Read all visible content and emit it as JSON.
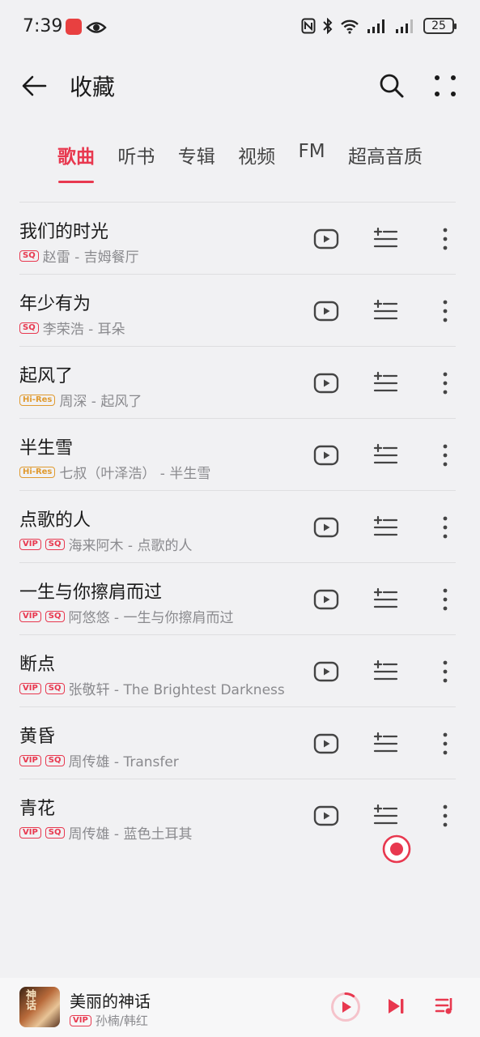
{
  "status_bar": {
    "time": "7:39",
    "battery": "25"
  },
  "header": {
    "title": "收藏"
  },
  "tabs": [
    {
      "label": "歌曲",
      "active": true
    },
    {
      "label": "听书",
      "active": false
    },
    {
      "label": "专辑",
      "active": false
    },
    {
      "label": "视频",
      "active": false
    },
    {
      "label": "FM",
      "active": false
    },
    {
      "label": "超高音质",
      "active": false
    }
  ],
  "songs": [
    {
      "title": "我们的时光",
      "badges": [
        "SQ"
      ],
      "subtitle": "赵雷 - 吉姆餐厅"
    },
    {
      "title": "年少有为",
      "badges": [
        "SQ"
      ],
      "subtitle": "李荣浩 - 耳朵"
    },
    {
      "title": "起风了",
      "badges": [
        "Hi-Res"
      ],
      "subtitle": "周深 - 起风了"
    },
    {
      "title": "半生雪",
      "badges": [
        "Hi-Res"
      ],
      "subtitle": "七叔（叶泽浩） - 半生雪"
    },
    {
      "title": "点歌的人",
      "badges": [
        "VIP",
        "SQ"
      ],
      "subtitle": "海来阿木 - 点歌的人"
    },
    {
      "title": "一生与你擦肩而过",
      "badges": [
        "VIP",
        "SQ"
      ],
      "subtitle": "阿悠悠 - 一生与你擦肩而过"
    },
    {
      "title": "断点",
      "badges": [
        "VIP",
        "SQ"
      ],
      "subtitle": "张敬轩 - The Brightest Darkness"
    },
    {
      "title": "黄昏",
      "badges": [
        "VIP",
        "SQ"
      ],
      "subtitle": "周传雄 - Transfer"
    },
    {
      "title": "青花",
      "badges": [
        "VIP",
        "SQ"
      ],
      "subtitle": "周传雄 - 蓝色土耳其"
    }
  ],
  "player": {
    "cover_text": "神话",
    "title": "美丽的神话",
    "badge": "VIP",
    "artist": "孙楠/韩红",
    "progress": 0.1
  },
  "colors": {
    "accent": "#e8384f",
    "hires": "#e09a2f",
    "background": "#f1f1f3"
  },
  "icons": [
    "back-arrow-icon",
    "search-icon",
    "more-dots-icon",
    "video-icon",
    "add-to-playlist-icon",
    "vertical-dots-icon",
    "record-icon",
    "play-icon",
    "next-icon",
    "playlist-icon"
  ]
}
